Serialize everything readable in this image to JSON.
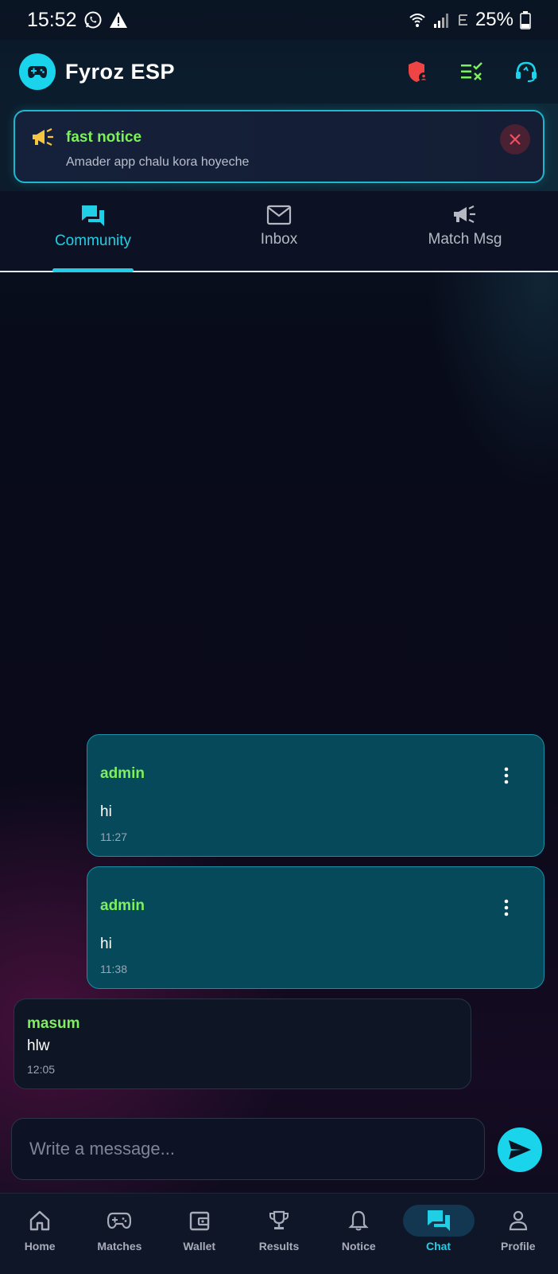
{
  "status_bar": {
    "time": "15:52",
    "battery": "25%"
  },
  "header": {
    "title": "Fyroz ESP"
  },
  "notice": {
    "title": "fast notice",
    "text": "Amader app chalu kora hoyeche"
  },
  "tabs": [
    {
      "label": "Community",
      "icon": "chat-bubbles-icon",
      "active": true
    },
    {
      "label": "Inbox",
      "icon": "envelope-icon",
      "active": false
    },
    {
      "label": "Match Msg",
      "icon": "megaphone-icon",
      "active": false
    }
  ],
  "messages": [
    {
      "sender": "admin",
      "text": "hi",
      "time": "11:27",
      "role": "admin"
    },
    {
      "sender": "admin",
      "text": "hi",
      "time": "11:38",
      "role": "admin"
    },
    {
      "sender": "masum",
      "text": "hlw",
      "time": "12:05",
      "role": "user"
    }
  ],
  "composer": {
    "placeholder": "Write a message..."
  },
  "bottom_nav": [
    {
      "label": "Home",
      "icon": "home-icon"
    },
    {
      "label": "Matches",
      "icon": "gamepad-icon"
    },
    {
      "label": "Wallet",
      "icon": "wallet-icon"
    },
    {
      "label": "Results",
      "icon": "trophy-icon"
    },
    {
      "label": "Notice",
      "icon": "bell-icon"
    },
    {
      "label": "Chat",
      "icon": "chat-bubbles-icon",
      "active": true
    },
    {
      "label": "Profile",
      "icon": "person-icon"
    }
  ],
  "colors": {
    "accent": "#19d4ea",
    "sender": "#7df05c",
    "admin_bubble": "#06495a"
  }
}
